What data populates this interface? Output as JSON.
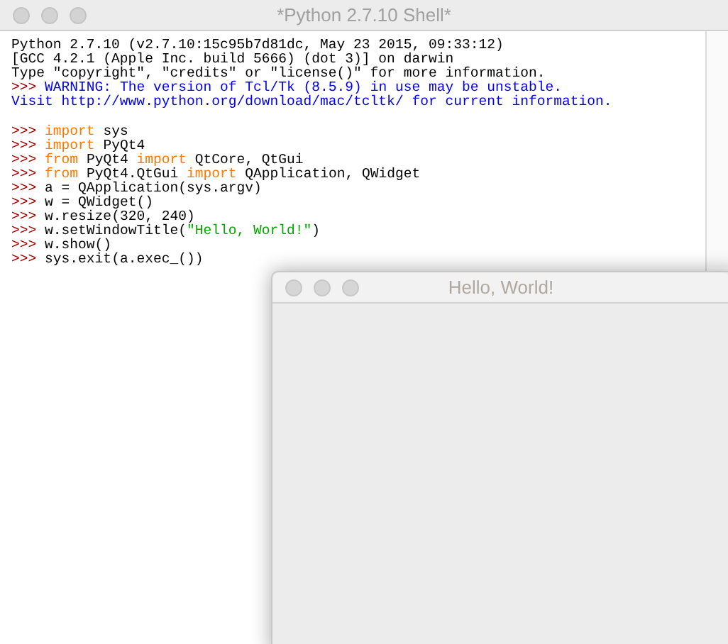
{
  "shell_window": {
    "title": "*Python 2.7.10 Shell*",
    "banner": [
      {
        "segments": [
          {
            "kind": "output",
            "text": "Python 2.7.10 (v2.7.10:15c95b7d81dc, May 23 2015, 09:33:12)"
          }
        ]
      },
      {
        "segments": [
          {
            "kind": "output",
            "text": "[GCC 4.2.1 (Apple Inc. build 5666) (dot 3)] on darwin"
          }
        ]
      },
      {
        "segments": [
          {
            "kind": "output",
            "text": "Type \"copyright\", \"credits\" or \"license()\" for more information."
          }
        ]
      },
      {
        "segments": [
          {
            "kind": "prompt",
            "text": ">>> "
          },
          {
            "kind": "info",
            "text": "WARNING: The version of Tcl/Tk (8.5.9) in use may be unstable."
          }
        ]
      },
      {
        "segments": [
          {
            "kind": "info",
            "text": "Visit http://www.python.org/download/mac/tcltk/ for current information."
          }
        ]
      }
    ],
    "session": [
      {
        "segments": [
          {
            "kind": "prompt",
            "text": ">>> "
          },
          {
            "kind": "keyword",
            "text": "import"
          },
          {
            "kind": "plain",
            "text": " sys"
          }
        ]
      },
      {
        "segments": [
          {
            "kind": "prompt",
            "text": ">>> "
          },
          {
            "kind": "keyword",
            "text": "import"
          },
          {
            "kind": "plain",
            "text": " PyQt4"
          }
        ]
      },
      {
        "segments": [
          {
            "kind": "prompt",
            "text": ">>> "
          },
          {
            "kind": "keyword",
            "text": "from"
          },
          {
            "kind": "plain",
            "text": " PyQt4 "
          },
          {
            "kind": "keyword",
            "text": "import"
          },
          {
            "kind": "plain",
            "text": " QtCore, QtGui"
          }
        ]
      },
      {
        "segments": [
          {
            "kind": "prompt",
            "text": ">>> "
          },
          {
            "kind": "keyword",
            "text": "from"
          },
          {
            "kind": "plain",
            "text": " PyQt4.QtGui "
          },
          {
            "kind": "keyword",
            "text": "import"
          },
          {
            "kind": "plain",
            "text": " QApplication, QWidget"
          }
        ]
      },
      {
        "segments": [
          {
            "kind": "prompt",
            "text": ">>> "
          },
          {
            "kind": "plain",
            "text": "a = QApplication(sys.argv)"
          }
        ]
      },
      {
        "segments": [
          {
            "kind": "prompt",
            "text": ">>> "
          },
          {
            "kind": "plain",
            "text": "w = QWidget()"
          }
        ]
      },
      {
        "segments": [
          {
            "kind": "prompt",
            "text": ">>> "
          },
          {
            "kind": "plain",
            "text": "w.resize(320, 240)"
          }
        ]
      },
      {
        "segments": [
          {
            "kind": "prompt",
            "text": ">>> "
          },
          {
            "kind": "plain",
            "text": "w.setWindowTitle("
          },
          {
            "kind": "string",
            "text": "\"Hello, World!\""
          },
          {
            "kind": "plain",
            "text": ")"
          }
        ]
      },
      {
        "segments": [
          {
            "kind": "prompt",
            "text": ">>> "
          },
          {
            "kind": "plain",
            "text": "w.show()"
          }
        ]
      },
      {
        "segments": [
          {
            "kind": "prompt",
            "text": ">>> "
          },
          {
            "kind": "plain",
            "text": "sys.exit(a.exec_())"
          }
        ]
      }
    ]
  },
  "qt_window": {
    "title": "Hello, World!"
  }
}
